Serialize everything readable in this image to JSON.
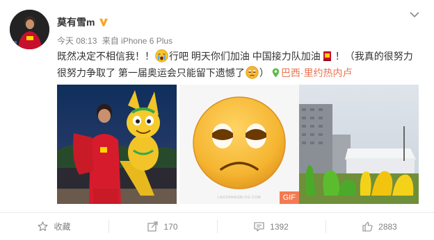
{
  "user": {
    "name": "莫有雪m",
    "verified_icon": "verified-v-icon",
    "avatar_icon": "avatar-icon"
  },
  "meta": {
    "time": "今天 08:13",
    "source": "来自 iPhone 6 Plus"
  },
  "post": {
    "text_1": "既然决定不相信我！！",
    "text_2": "行吧 明天你们加油 中国接力队加油",
    "text_3": "！（我真的很努力很努力争取了 第一届奥运会只能留下遗憾了",
    "text_4": "）",
    "location": "巴西·里约热内卢",
    "emojis": [
      "crying-face-icon",
      "cup-icon",
      "unamused-face-icon"
    ]
  },
  "images": {
    "count": 3,
    "gif_badge": "GIF",
    "watermark": "LAOZHANGBLOG.COM"
  },
  "actions": {
    "favorite": "收藏",
    "forward": "170",
    "comment": "1392",
    "like": "2883"
  },
  "colors": {
    "accent": "#eb7350",
    "verified": "#f5a623",
    "text": "#333333",
    "muted": "#808080"
  }
}
